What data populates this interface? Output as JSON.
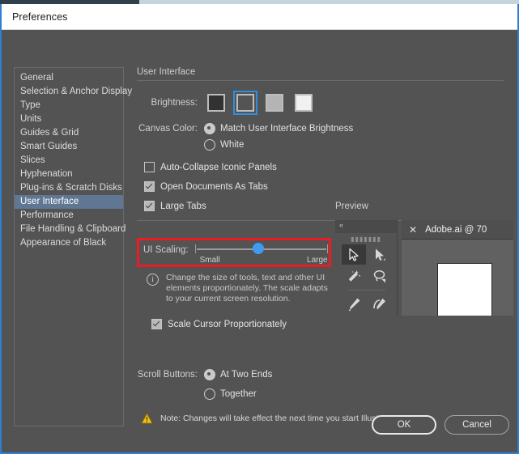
{
  "window": {
    "title": "Preferences"
  },
  "sidebar": {
    "items": [
      {
        "label": "General",
        "selected": false
      },
      {
        "label": "Selection & Anchor Display",
        "selected": false
      },
      {
        "label": "Type",
        "selected": false
      },
      {
        "label": "Units",
        "selected": false
      },
      {
        "label": "Guides & Grid",
        "selected": false
      },
      {
        "label": "Smart Guides",
        "selected": false
      },
      {
        "label": "Slices",
        "selected": false
      },
      {
        "label": "Hyphenation",
        "selected": false
      },
      {
        "label": "Plug-ins & Scratch Disks",
        "selected": false
      },
      {
        "label": "User Interface",
        "selected": true
      },
      {
        "label": "Performance",
        "selected": false
      },
      {
        "label": "File Handling & Clipboard",
        "selected": false
      },
      {
        "label": "Appearance of Black",
        "selected": false
      }
    ]
  },
  "panel": {
    "section_title": "User Interface",
    "brightness": {
      "label": "Brightness:",
      "swatches": [
        {
          "name": "dark",
          "color": "#323232",
          "selected": false
        },
        {
          "name": "medium-dark",
          "color": "#545454",
          "selected": true
        },
        {
          "name": "light-gray",
          "color": "#b4b4b4",
          "selected": false
        },
        {
          "name": "white",
          "color": "#f1f1f1",
          "selected": false
        }
      ]
    },
    "canvas_color": {
      "label": "Canvas Color:",
      "options": [
        {
          "label": "Match User Interface Brightness",
          "selected": true
        },
        {
          "label": "White",
          "selected": false
        }
      ]
    },
    "checkboxes": [
      {
        "label": "Auto-Collapse Iconic Panels",
        "checked": false
      },
      {
        "label": "Open Documents As Tabs",
        "checked": true
      },
      {
        "label": "Large Tabs",
        "checked": true
      }
    ],
    "ui_scaling": {
      "label": "UI Scaling:",
      "min_label": "Small",
      "max_label": "Large",
      "value_percent": 48,
      "highlight_color": "#ee1b24"
    },
    "info_note": {
      "icon": "info-icon",
      "text": "Change the size of tools, text and other UI elements proportionately. The scale adapts to your current screen resolution."
    },
    "scale_cursor": {
      "label": "Scale Cursor Proportionately",
      "checked": true
    },
    "scroll_buttons": {
      "label": "Scroll Buttons:",
      "options": [
        {
          "label": "At Two Ends",
          "selected": true
        },
        {
          "label": "Together",
          "selected": false
        }
      ]
    },
    "footer_note": {
      "icon": "warning-icon",
      "text": "Note:  Changes will take effect the next time you start Illustrator."
    }
  },
  "preview": {
    "title": "Preview",
    "toolbar": {
      "collapse_icon": "double-chevron-left-icon",
      "tools": [
        {
          "name": "selection-tool-icon",
          "active": true
        },
        {
          "name": "direct-selection-tool-icon",
          "active": false
        },
        {
          "name": "magic-wand-tool-icon",
          "active": false
        },
        {
          "name": "lasso-tool-icon",
          "active": false
        },
        {
          "name": "pen-tool-icon",
          "active": false
        },
        {
          "name": "curvature-pen-tool-icon",
          "active": false
        }
      ]
    },
    "document_tab": {
      "close_icon": "close-icon",
      "label": "Adobe.ai @ 70"
    }
  },
  "footer": {
    "ok_label": "OK",
    "cancel_label": "Cancel"
  }
}
